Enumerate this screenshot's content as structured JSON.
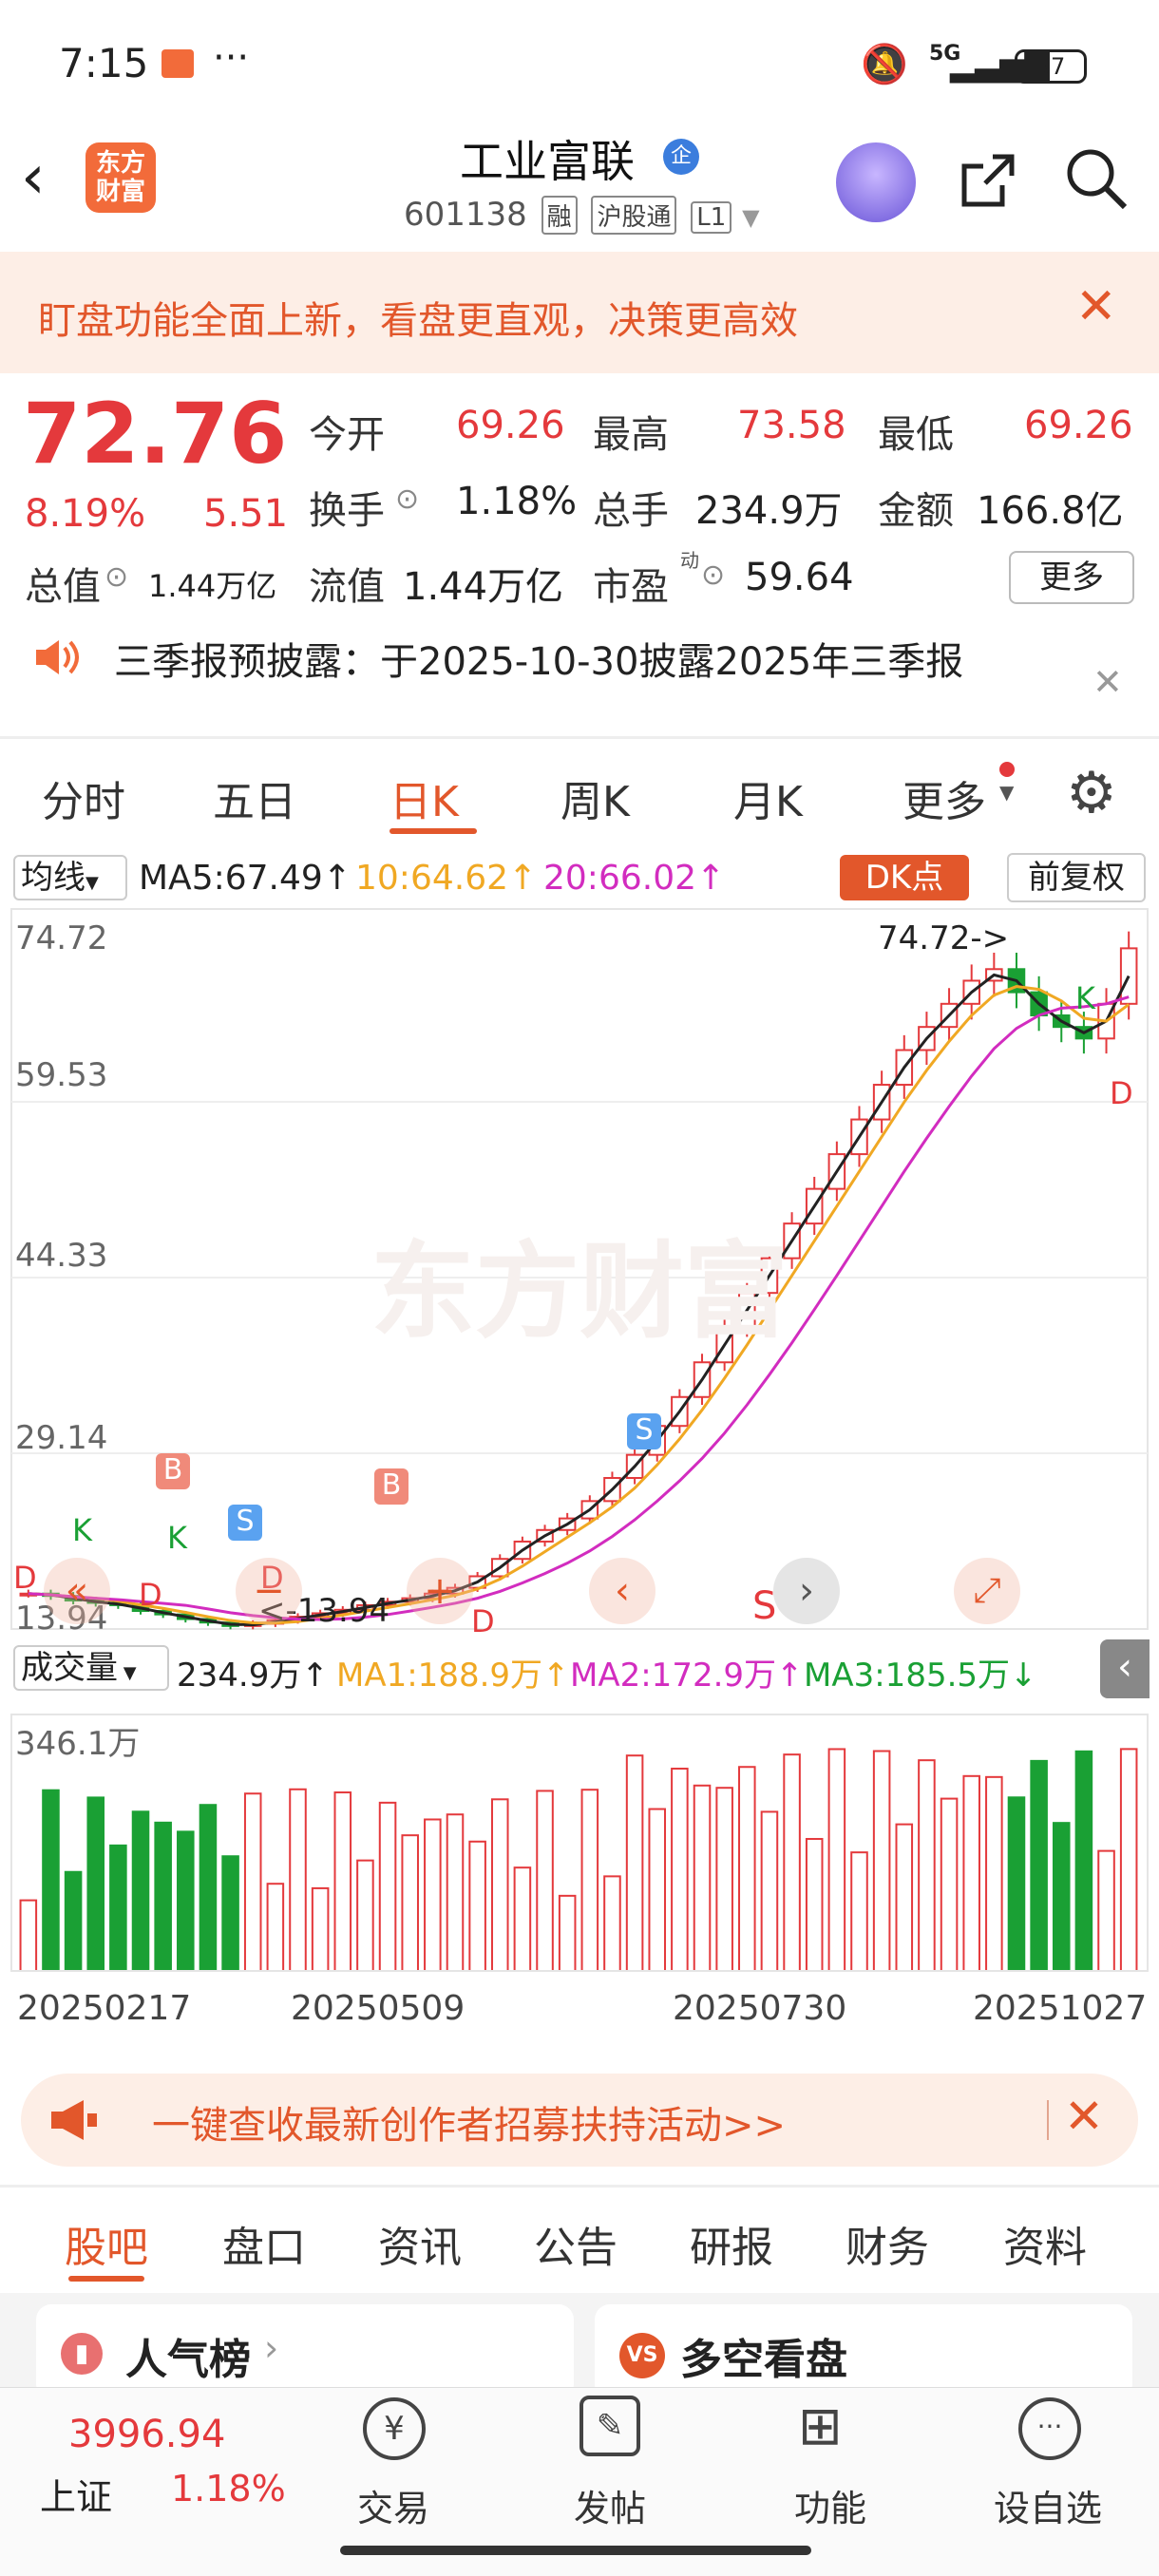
{
  "status": {
    "time": "7:15",
    "dots": "···",
    "network": "5G",
    "battery": "57"
  },
  "header": {
    "logo": "东方\n财富",
    "title": "工业富联",
    "corp_badge": "企",
    "code": "601138",
    "tags": [
      "融",
      "沪股通",
      "L1"
    ]
  },
  "notice": {
    "text": "盯盘功能全面上新，看盘更直观，决策更高效"
  },
  "quote": {
    "price": "72.76",
    "change_pct": "8.19%",
    "change": "5.51",
    "open_label": "今开",
    "open": "69.26",
    "high_label": "最高",
    "high": "73.58",
    "low_label": "最低",
    "low": "69.26",
    "turnover_label": "换手",
    "turnover": "1.18%",
    "volume_label": "总手",
    "volume": "234.9万",
    "amount_label": "金额",
    "amount": "166.8亿",
    "mktcap_label": "总值",
    "mktcap": "1.44万亿",
    "float_label": "流值",
    "float": "1.44万亿",
    "pe_label": "市盈",
    "pe_sup": "动",
    "pe": "59.64",
    "more": "更多"
  },
  "announcement": {
    "text": "三季报预披露：于2025-10-30披露2025年三季报"
  },
  "chart_tabs": [
    "分时",
    "五日",
    "日K",
    "周K",
    "月K",
    "更多"
  ],
  "ma_bar": {
    "selector": "均线",
    "ma5": "MA5:67.49↑",
    "ma10": "10:64.62↑",
    "ma20": "20:66.02↑",
    "dk": "DK点",
    "adjust": "前复权"
  },
  "chart_data": {
    "type": "candlestick",
    "y_ticks": [
      "74.72",
      "59.53",
      "44.33",
      "29.14",
      "13.94"
    ],
    "annotations": {
      "max": "74.72->",
      "min": "<-13.94"
    },
    "markers": [
      "B",
      "B",
      "S",
      "S",
      "K",
      "K",
      "K",
      "D",
      "D",
      "D",
      "D",
      "D"
    ],
    "x_labels": [
      "20250217",
      "20250509",
      "20250730",
      "20251027"
    ],
    "close_series": [
      17,
      16.8,
      16.4,
      16.2,
      16,
      15.5,
      15.2,
      14.8,
      14.5,
      14.2,
      14.4,
      14.7,
      15,
      15.3,
      15.6,
      16,
      16.3,
      16.6,
      17,
      17.5,
      18.5,
      20,
      21.5,
      22.5,
      23.5,
      25,
      27,
      29,
      31.5,
      34,
      37,
      40,
      43,
      46,
      49,
      52,
      55,
      58,
      61,
      64,
      66,
      68,
      70,
      71,
      69,
      67,
      66,
      65,
      68,
      72.8
    ]
  },
  "volume_bar": {
    "selector": "成交量",
    "vol": "234.9万↑",
    "ma1": "MA1:188.9万↑",
    "ma2": "MA2:172.9万↑",
    "ma3": "MA3:185.5万↓",
    "max_label": "346.1万"
  },
  "banner2": {
    "text": "一键查收最新创作者招募扶持活动>>"
  },
  "bottom_tabs": [
    "股吧",
    "盘口",
    "资讯",
    "公告",
    "研报",
    "财务",
    "资料"
  ],
  "cards": [
    {
      "title": "人气榜"
    },
    {
      "title": "多空看盘"
    }
  ],
  "index": {
    "value": "3996.94",
    "name": "上证",
    "pct": "1.18%"
  },
  "nav": [
    "交易",
    "发帖",
    "功能",
    "设自选"
  ],
  "colors": {
    "accent": "#e2572b",
    "up": "#e4393c",
    "down": "#1aa034"
  }
}
